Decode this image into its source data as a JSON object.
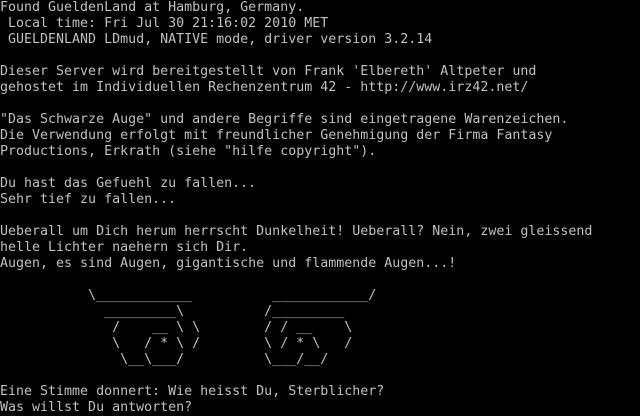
{
  "terminal": {
    "fg_color": "#c0c0c0",
    "bg_color": "#000000",
    "lines": [
      "Found GueldenLand at Hamburg, Germany.",
      " Local time: Fri Jul 30 21:16:02 2010 MET",
      " GUELDENLAND LDmud, NATIVE mode, driver version 3.2.14",
      "",
      "Dieser Server wird bereitgestellt von Frank 'Elbereth' Altpeter und",
      "gehostet im Individuellen Rechenzentrum 42 - http://www.irz42.net/",
      "",
      "\"Das Schwarze Auge\" und andere Begriffe sind eingetragene Warenzeichen.",
      "Die Verwendung erfolgt mit freundlicher Genehmigung der Firma Fantasy",
      "Productions, Erkrath (siehe \"hilfe copyright\").",
      "",
      "Du hast das Gefuehl zu fallen...",
      "Sehr tief zu fallen...",
      "",
      "Ueberall um Dich herum herrscht Dunkelheit! Ueberall? Nein, zwei gleissend",
      "helle Lichter naehern sich Dir.",
      "Augen, es sind Augen, gigantische und flammende Augen...!",
      "",
      "           \\____________          ____________/",
      "             _________\\          /_________",
      "              /    __ \\ \\        / / __    \\",
      "              \\   / * \\ /        \\ / * \\   /",
      "               \\__\\___/          \\___/__/",
      "",
      "Eine Stimme donnert: Wie heisst Du, Sterblicher?",
      "Was willst Du antworten?"
    ]
  }
}
